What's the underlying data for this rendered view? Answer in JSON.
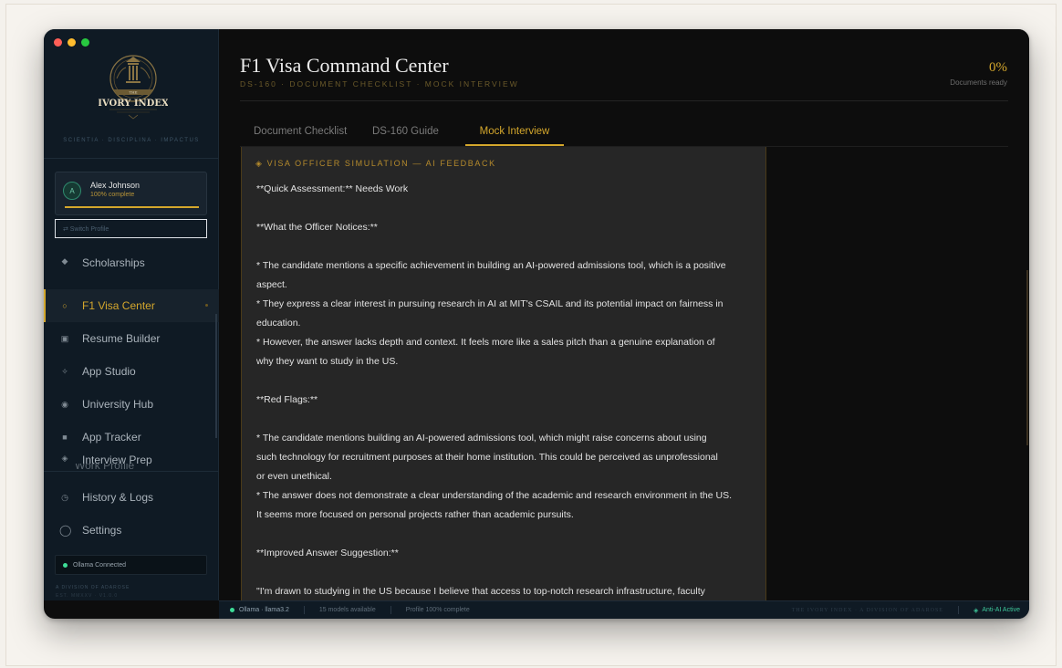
{
  "window": {
    "title": "F1 Visa Command Center"
  },
  "sidebar": {
    "brand_line1": "THE",
    "brand_name": "IVORY INDEX",
    "tagline": "SCIENTIA · DISCIPLINA · IMPACTUS",
    "user": {
      "initial": "A",
      "name": "Alex Johnson",
      "progress_text": "100% complete",
      "progress": 1.0
    },
    "switch_profile": "⇄ Switch Profile",
    "items": [
      {
        "label": "Scholarships",
        "icon": "diamond-icon"
      },
      {
        "label": "F1 Visa Center",
        "icon": "circle-outline-icon",
        "active": true
      },
      {
        "label": "Resume Builder",
        "icon": "document-icon"
      },
      {
        "label": "App Studio",
        "icon": "sparkle-icon"
      },
      {
        "label": "University Hub",
        "icon": "globe-icon"
      },
      {
        "label": "App Tracker",
        "icon": "square-icon"
      },
      {
        "label": "Interview Prep",
        "icon": "diamond-icon"
      },
      {
        "label": "History & Logs",
        "icon": "history-icon"
      },
      {
        "label": "Settings",
        "icon": "circle-icon"
      }
    ],
    "partial_item": "Work Profile",
    "ollama_status": "Ollama Connected",
    "footer_line1": "A DIVISION OF ADAROSE",
    "footer_line2": "EST. MMXXV · V1.0.0"
  },
  "header": {
    "title": "F1 Visa Command Center",
    "subtitle": "DS-160 · DOCUMENT CHECKLIST · MOCK INTERVIEW",
    "percent": "0%",
    "percent_label": "Documents ready"
  },
  "tabs": [
    {
      "label": "Document Checklist"
    },
    {
      "label": "DS-160 Guide"
    },
    {
      "label": "Mock Interview",
      "active": true
    }
  ],
  "feedback": {
    "heading": "◈ VISA OFFICER SIMULATION — AI FEEDBACK",
    "lines": [
      "**Quick Assessment:** Needs Work",
      "",
      "**What the Officer Notices:**",
      "",
      "* The candidate mentions a specific achievement in building an AI-powered admissions tool, which is a positive",
      "aspect.",
      "* They express a clear interest in pursuing research in AI at MIT's CSAIL and its potential impact on fairness in",
      "education.",
      "* However, the answer lacks depth and context. It feels more like a sales pitch than a genuine explanation of",
      "why they want to study in the US.",
      "",
      "**Red Flags:**",
      "",
      "* The candidate mentions building an AI-powered admissions tool, which might raise concerns about using",
      "such technology for recruitment purposes at their home institution. This could be perceived as unprofessional",
      "or even unethical.",
      "* The answer does not demonstrate a clear understanding of the academic and research environment in the US.",
      "It seems more focused on personal projects rather than academic pursuits.",
      "",
      "**Improved Answer Suggestion:**",
      "",
      "\"I'm drawn to studying in the US because I believe that access to top-notch research infrastructure, faculty"
    ]
  },
  "status": {
    "ollama": "Ollama · llama3.2",
    "models": "15 models available",
    "profile": "Profile 100% complete",
    "brand": "THE IVORY INDEX · A DIVISION OF ADAROSE",
    "anti_ai": "Anti-AI Active"
  },
  "colors": {
    "accent": "#d4a72c",
    "sidebar_bg": "#0f1a24",
    "main_bg": "#0d0d0d",
    "panel_bg": "#262626",
    "success": "#3ddc97"
  }
}
